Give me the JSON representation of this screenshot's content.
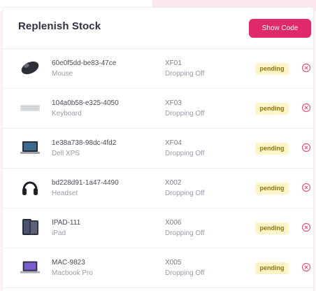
{
  "header": {
    "title": "Replenish Stock",
    "show_code_label": "Show Code"
  },
  "colors": {
    "accent": "#e0296b",
    "pending_bg": "#fff5c8",
    "remove_icon": "#e45a7a"
  },
  "items": [
    {
      "id": "60e0f5dd-be83-47ce",
      "name": "Mouse",
      "location": "XF01",
      "status": "Dropping Off",
      "badge": "pending",
      "icon": "mouse-icon"
    },
    {
      "id": "104a0b58-e325-4050",
      "name": "Keyboard",
      "location": "XF03",
      "status": "Dropping Off",
      "badge": "pending",
      "icon": "keyboard-icon"
    },
    {
      "id": "1e38a738-98dc-4fd2",
      "name": "Dell XPS",
      "location": "XF04",
      "status": "Dropping Off",
      "badge": "pending",
      "icon": "laptop-icon"
    },
    {
      "id": "bd228d91-1a47-4490",
      "name": "Headset",
      "location": "X002",
      "status": "Dropping Off",
      "badge": "pending",
      "icon": "headset-icon"
    },
    {
      "id": "IPAD-111",
      "name": "iPad",
      "location": "X006",
      "status": "Dropping Off",
      "badge": "pending",
      "icon": "tablet-icon"
    },
    {
      "id": "MAC-9823",
      "name": "Macbook Pro",
      "location": "X005",
      "status": "Dropping Off",
      "badge": "pending",
      "icon": "macbook-icon"
    }
  ]
}
